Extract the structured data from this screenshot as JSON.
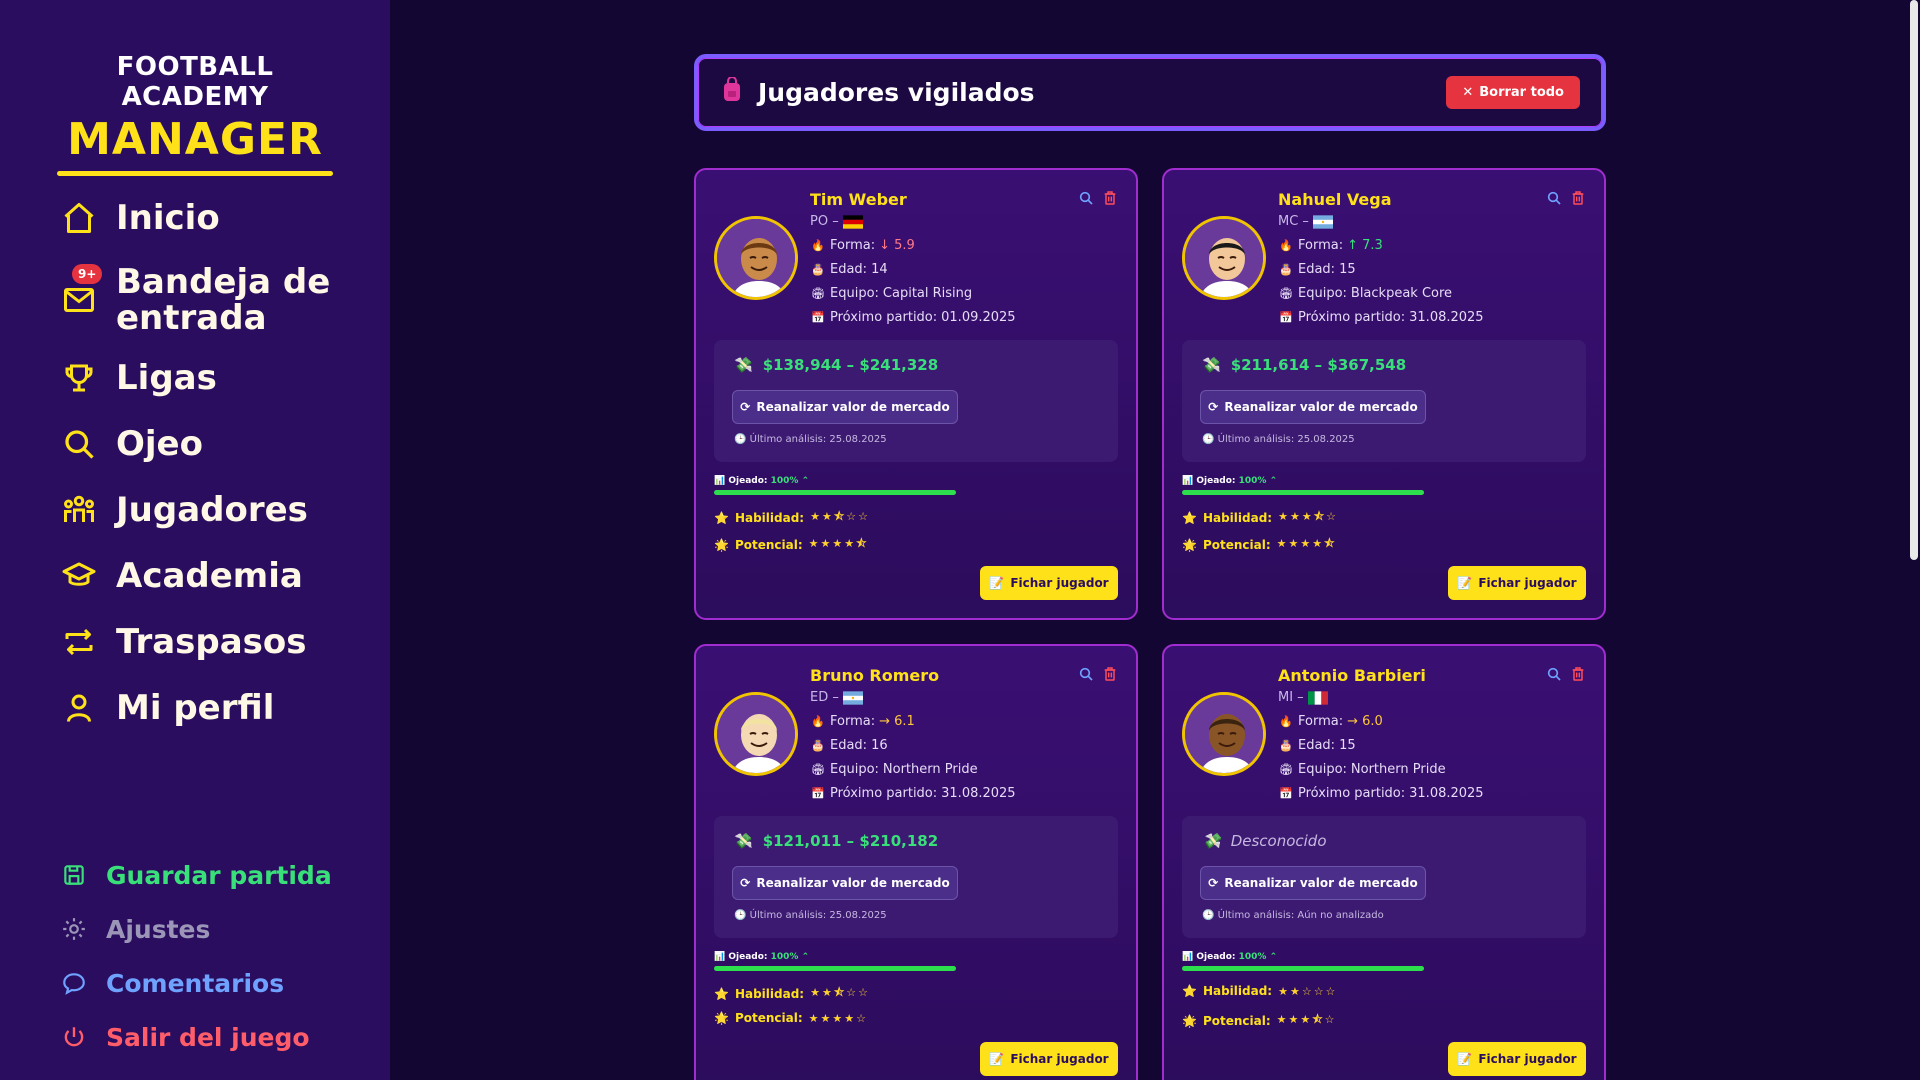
{
  "logo": {
    "top": "FOOTBALL ACADEMY",
    "main": "MANAGER"
  },
  "nav": [
    {
      "label": "Inicio",
      "icon": "home-icon"
    },
    {
      "label": "Bandeja de entrada",
      "icon": "mail-icon",
      "badge": "9+"
    },
    {
      "label": "Ligas",
      "icon": "trophy-icon"
    },
    {
      "label": "Ojeo",
      "icon": "search-icon"
    },
    {
      "label": "Jugadores",
      "icon": "players-icon"
    },
    {
      "label": "Academia",
      "icon": "graduation-icon"
    },
    {
      "label": "Traspasos",
      "icon": "transfer-icon"
    },
    {
      "label": "Mi perfil",
      "icon": "user-icon"
    }
  ],
  "bottom_nav": [
    {
      "label": "Guardar partida",
      "icon": "save-icon",
      "color": "#39e07a"
    },
    {
      "label": "Ajustes",
      "icon": "gear-icon",
      "color": "#9b95b8"
    },
    {
      "label": "Comentarios",
      "icon": "comment-icon",
      "color": "#6fa2ff"
    },
    {
      "label": "Salir del juego",
      "icon": "power-icon",
      "color": "#ff5d6a"
    }
  ],
  "header": {
    "title": "Jugadores vigilados",
    "clear_label": "Borrar todo"
  },
  "labels": {
    "forma": "Forma:",
    "edad": "Edad:",
    "equipo": "Equipo:",
    "proximo": "Próximo partido:",
    "reanalizar": "Reanalizar valor de mercado",
    "ultimo": "Último análisis:",
    "ojeado": "Ojeado:",
    "habilidad": "Habilidad:",
    "potencial": "Potencial:",
    "fichar": "Fichar jugador"
  },
  "players": [
    {
      "name": "Tim Weber",
      "pos": "PO –",
      "flag": "de",
      "form_arrow": "↓",
      "form": "5.9",
      "form_color": "#ff7a8a",
      "age": "14",
      "team": "Capital Rising",
      "next": "01.09.2025",
      "value": "$138,944 – $241,328",
      "last": "25.08.2025",
      "scouted": "100%",
      "skill_stars": "★★⯪☆☆",
      "potential_stars": "★★★★⯪",
      "skin": "#c98a4a",
      "hair": "#6b3a12"
    },
    {
      "name": "Nahuel Vega",
      "pos": "MC –",
      "flag": "ar",
      "form_arrow": "↑",
      "form": "7.3",
      "form_color": "#39e07a",
      "age": "15",
      "team": "Blackpeak Core",
      "next": "31.08.2025",
      "value": "$211,614 – $367,548",
      "last": "25.08.2025",
      "scouted": "100%",
      "skill_stars": "★★★⯪☆",
      "potential_stars": "★★★★⯪",
      "skin": "#f2c79a",
      "hair": "#1a1a1a"
    },
    {
      "name": "Bruno Romero",
      "pos": "ED –",
      "flag": "ar",
      "form_arrow": "→",
      "form": "6.1",
      "form_color": "#ffc83a",
      "age": "16",
      "team": "Northern Pride",
      "next": "31.08.2025",
      "value": "$121,011 – $210,182",
      "last": "25.08.2025",
      "scouted": "100%",
      "skill_stars": "★★⯪☆☆",
      "potential_stars": "★★★★☆",
      "skin": "#f5d9b5",
      "hair": "#f3e3a0"
    },
    {
      "name": "Antonio Barbieri",
      "pos": "MI –",
      "flag": "it",
      "form_arrow": "→",
      "form": "6.0",
      "form_color": "#ffc83a",
      "age": "15",
      "team": "Northern Pride",
      "next": "31.08.2025",
      "value": "Desconocido",
      "last": "Aún no analizado",
      "scouted": "100%",
      "skill_stars": "★★☆☆☆",
      "potential_stars": "★★★⯪☆",
      "skin": "#8a5526",
      "hair": "#3a2410"
    }
  ]
}
